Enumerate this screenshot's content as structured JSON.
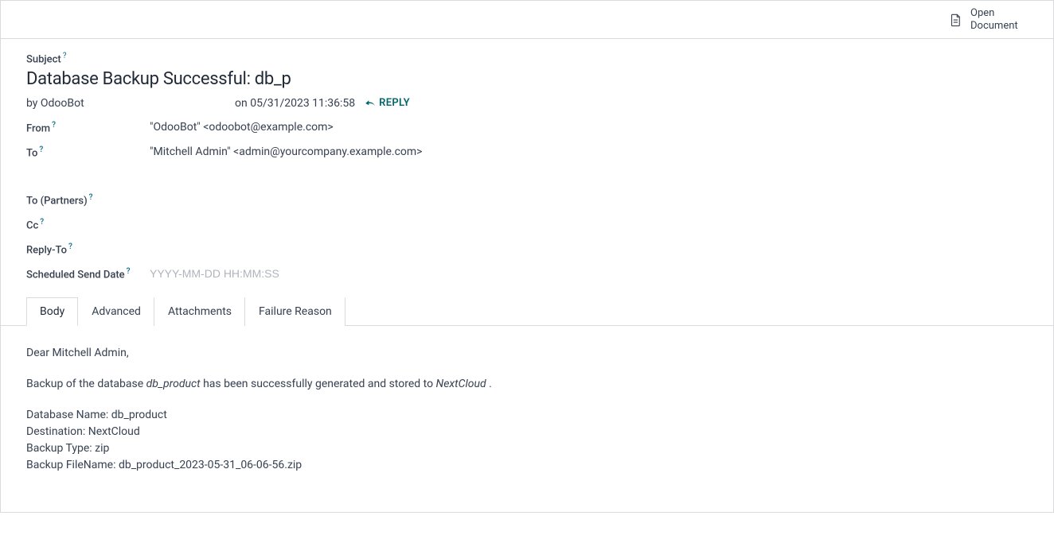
{
  "header": {
    "open_document": "Open Document"
  },
  "labels": {
    "subject": "Subject",
    "from": "From",
    "to": "To",
    "to_partners": "To (Partners)",
    "cc": "Cc",
    "reply_to": "Reply-To",
    "scheduled_send_date": "Scheduled Send Date"
  },
  "email": {
    "subject": "Database Backup Successful: db_p",
    "by_prefix": "by ",
    "by_author": "OdooBot",
    "date_prefix": "on ",
    "date": "05/31/2023 11:36:58",
    "reply": "REPLY",
    "from": "\"OdooBot\" <odoobot@example.com>",
    "to": "\"Mitchell Admin\" <admin@yourcompany.example.com>",
    "scheduled_placeholder": "YYYY-MM-DD HH:MM:SS"
  },
  "tabs": [
    {
      "label": "Body",
      "active": true
    },
    {
      "label": "Advanced",
      "active": false
    },
    {
      "label": "Attachments",
      "active": false
    },
    {
      "label": "Failure Reason",
      "active": false
    }
  ],
  "body": {
    "greeting": "Dear Mitchell Admin,",
    "line2_pre": "Backup of the database ",
    "line2_db": "db_product",
    "line2_mid": " has been successfully generated and stored to ",
    "line2_dest": "NextCloud",
    "line2_post": " .",
    "details": {
      "db_name": "Database Name: db_product",
      "destination": "Destination: NextCloud",
      "backup_type": "Backup Type: zip",
      "backup_filename": "Backup FileName: db_product_2023-05-31_06-06-56.zip"
    }
  }
}
